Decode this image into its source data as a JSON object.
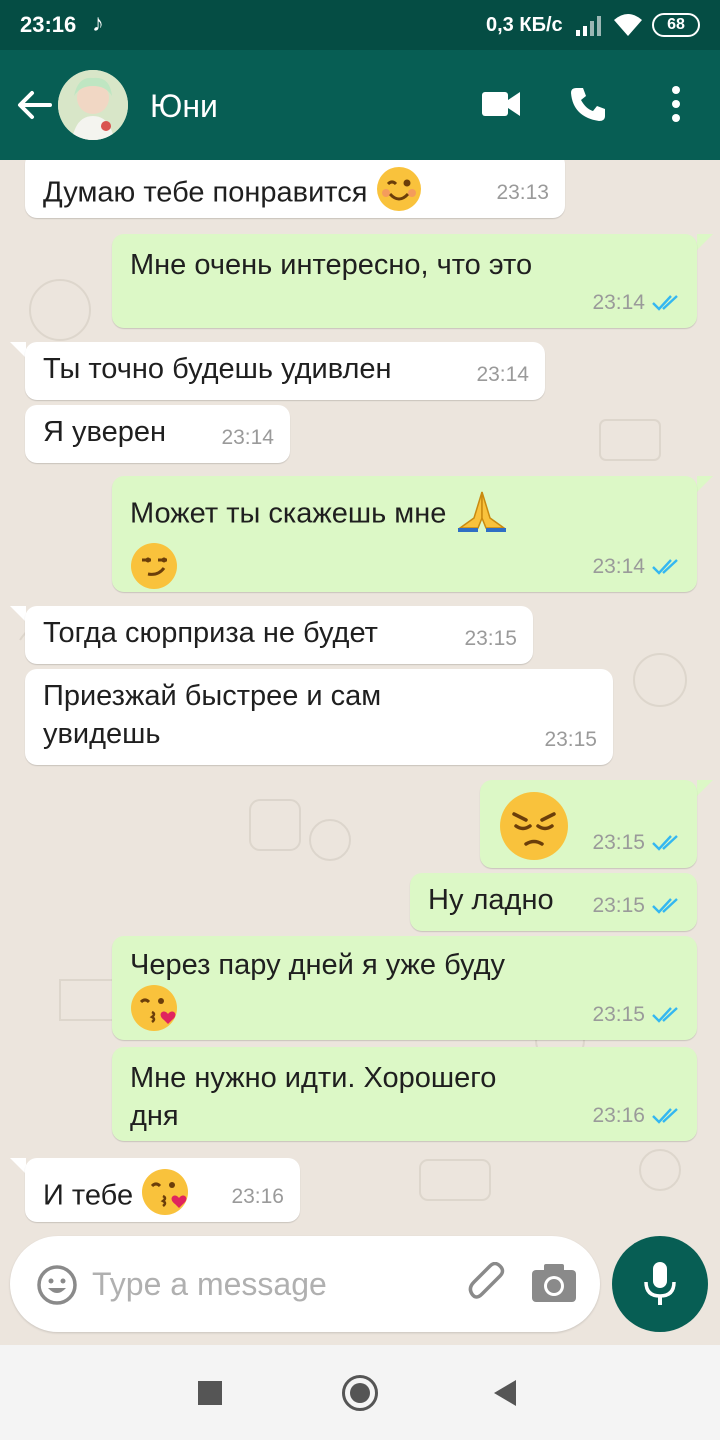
{
  "status_bar": {
    "time": "23:16",
    "tiktok_glyph": "♪",
    "speed": "0,3 КБ/с",
    "battery": "68",
    "icons": [
      "tiktok-icon",
      "signal-icon",
      "wifi-icon",
      "battery-icon"
    ]
  },
  "header": {
    "contact_name": "Юни",
    "icons": [
      "back-arrow-icon",
      "video-call-icon",
      "phone-icon",
      "more-vert-icon"
    ]
  },
  "messages": [
    {
      "dir": "in",
      "text": "Думаю тебе понравится",
      "emoji": "wink",
      "time": "23:13"
    },
    {
      "dir": "out",
      "text": "Мне очень интересно, что это",
      "time": "23:14",
      "status": "read"
    },
    {
      "dir": "in",
      "text": "Ты точно будешь удивлен",
      "time": "23:14"
    },
    {
      "dir": "in",
      "text": "Я уверен",
      "time": "23:14"
    },
    {
      "dir": "out",
      "text": "Может ты скажешь мне",
      "emoji": "pray smirk",
      "time": "23:14",
      "status": "read"
    },
    {
      "dir": "in",
      "text": "Тогда сюрприза не будет",
      "time": "23:15"
    },
    {
      "dir": "in",
      "text": "Приезжай быстрее и сам увидешь",
      "time": "23:15"
    },
    {
      "dir": "out",
      "text": "",
      "emoji": "pensive",
      "time": "23:15",
      "status": "read"
    },
    {
      "dir": "out",
      "text": "Ну ладно",
      "time": "23:15",
      "status": "read"
    },
    {
      "dir": "out",
      "text": "Через пару дней я уже буду",
      "emoji": "kiss",
      "time": "23:15",
      "status": "read"
    },
    {
      "dir": "out",
      "text": "Мне нужно идти. Хорошего дня",
      "time": "23:16",
      "status": "read"
    },
    {
      "dir": "in",
      "text": "И тебе",
      "emoji": "kiss",
      "time": "23:16"
    }
  ],
  "composer": {
    "placeholder": "Type a message",
    "icons": [
      "emoji-icon",
      "attach-icon",
      "camera-icon",
      "mic-icon"
    ]
  },
  "navbar": {
    "icons": [
      "recents-icon",
      "home-icon",
      "back-icon"
    ]
  },
  "colors": {
    "header": "#075e54",
    "status_bar": "#054d44",
    "incoming_bubble": "#ffffff",
    "outgoing_bubble": "#dcf8c6",
    "read_tick": "#34b7f1",
    "chat_bg": "#ece5dd"
  }
}
